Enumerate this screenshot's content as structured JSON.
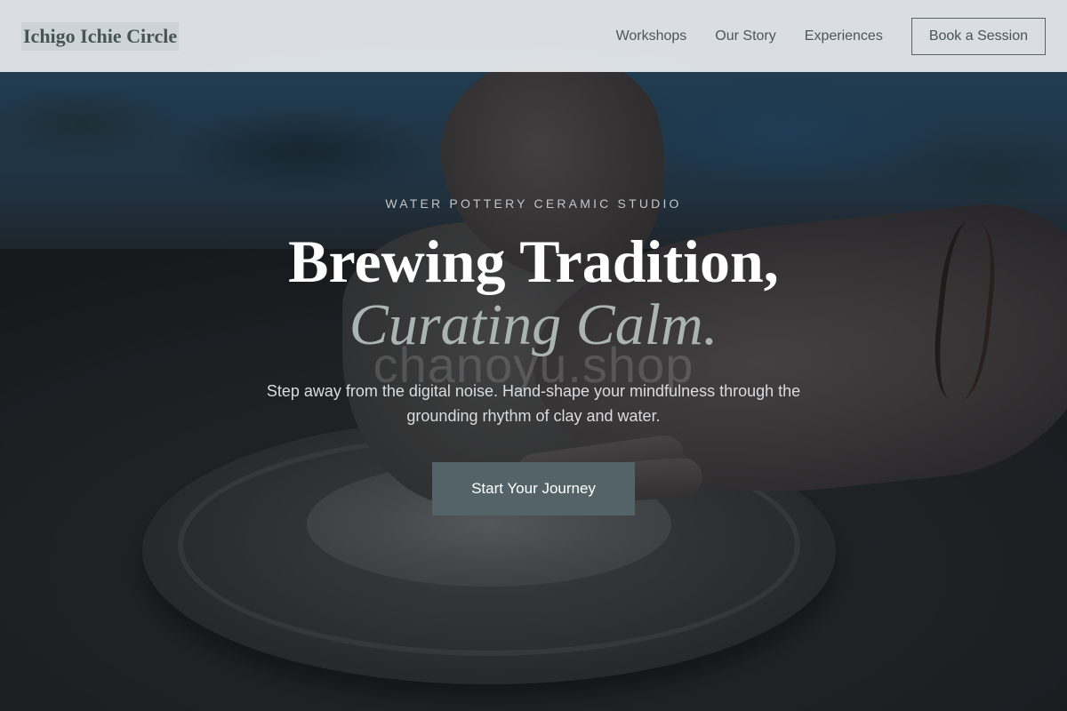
{
  "header": {
    "logo": "Ichigo Ichie Circle",
    "nav": [
      {
        "label": "Workshops"
      },
      {
        "label": "Our Story"
      },
      {
        "label": "Experiences"
      }
    ],
    "cta_label": "Book a Session"
  },
  "hero": {
    "eyebrow": "WATER POTTERY CERAMIC STUDIO",
    "headline_line1": "Brewing Tradition,",
    "headline_line2": "Curating Calm.",
    "watermark": "chanoyu.shop",
    "subtitle": "Step away from the digital noise. Hand-shape your mindfulness through the grounding rhythm of clay and water.",
    "cta_label": "Start Your Journey"
  },
  "colors": {
    "header_bg": "#e8ecf0",
    "accent": "#536367",
    "headline": "#ffffff",
    "headline_italic": "#aab4b1"
  }
}
